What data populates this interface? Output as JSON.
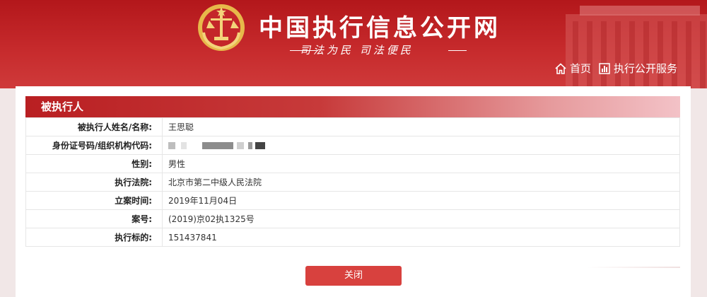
{
  "header": {
    "site_title": "中国执行信息公开网",
    "slogan": "司法为民  司法便民",
    "nav": [
      {
        "label": "首页",
        "icon": "home-icon"
      },
      {
        "label": "执行公开服务",
        "icon": "chart-bar-icon"
      }
    ]
  },
  "section": {
    "title": "被执行人"
  },
  "details": [
    {
      "label": "被执行人姓名/名称:",
      "value": "王思聪"
    },
    {
      "label": "身份证号码/组织机构代码:",
      "value": ""
    },
    {
      "label": "性别:",
      "value": "男性"
    },
    {
      "label": "执行法院:",
      "value": "北京市第二中级人民法院"
    },
    {
      "label": "立案时间:",
      "value": "2019年11月04日"
    },
    {
      "label": "案号:",
      "value": "(2019)京02执1325号"
    },
    {
      "label": "执行标的:",
      "value": "151437841"
    }
  ],
  "actions": {
    "close_label": "关闭"
  },
  "colors": {
    "banner_red": "#c62a2c",
    "button_red": "#d8413e"
  }
}
